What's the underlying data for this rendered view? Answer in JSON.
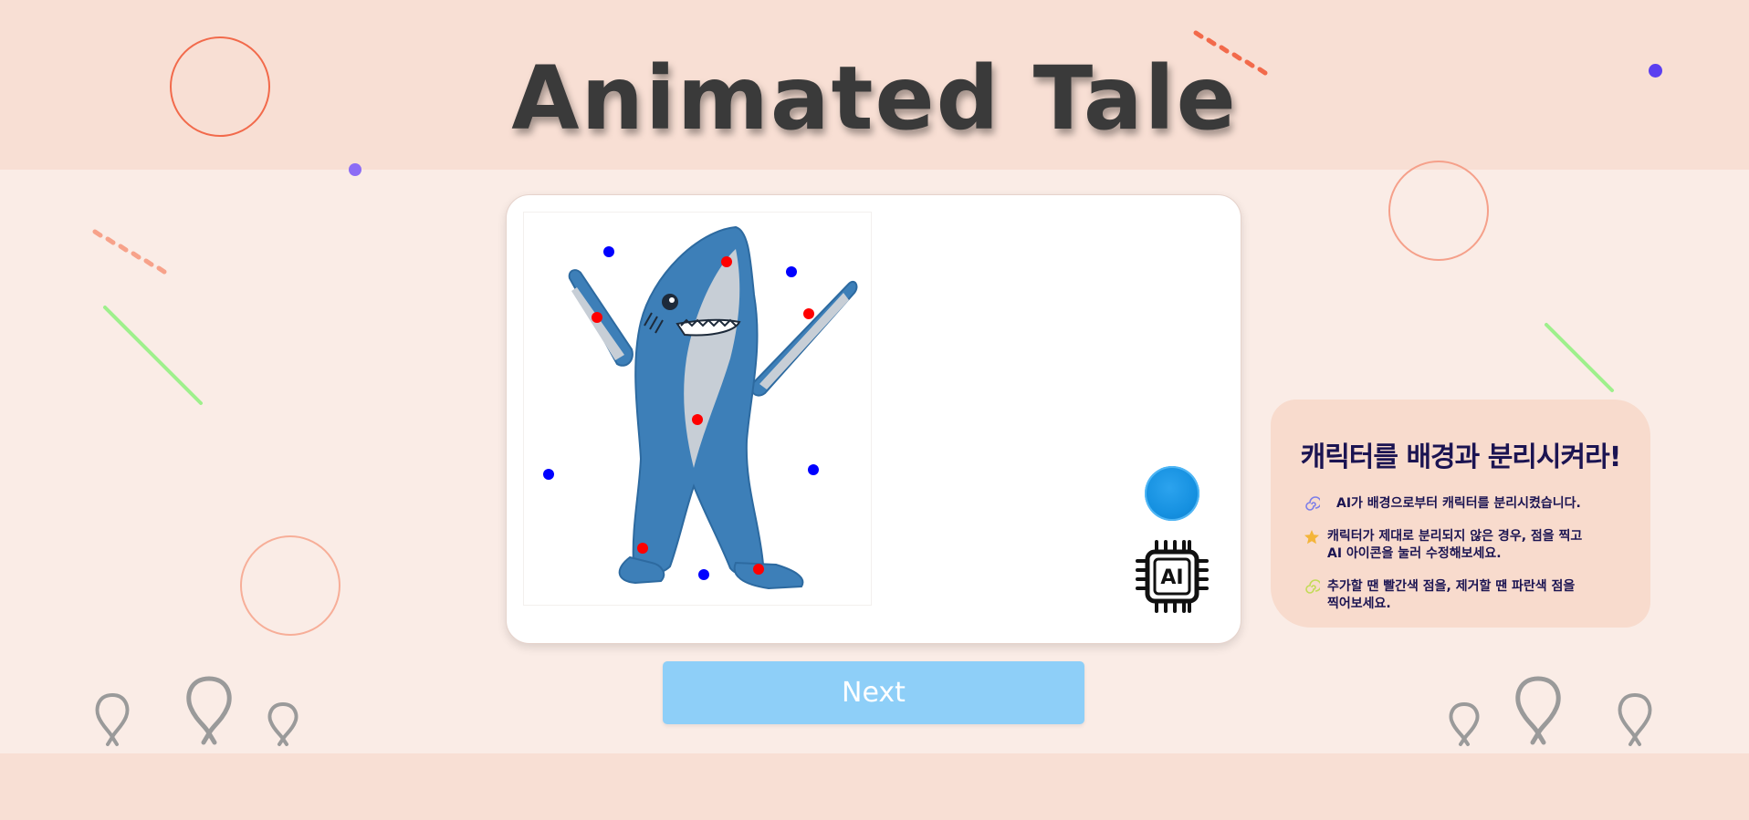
{
  "header": {
    "title": "Animated Tale"
  },
  "card": {
    "image_alt": "shark character",
    "orb_label": "",
    "ai_label": "AI"
  },
  "next_button": {
    "label": "Next"
  },
  "info": {
    "title": "캐릭터를 배경과 분리시켜라!",
    "items": [
      {
        "icon": "spiral-icon",
        "line1": "AI가 배경으로부터 캐릭터를 분리시켰습니다.",
        "line2": ""
      },
      {
        "icon": "star-icon",
        "line1": "캐릭터가 제대로 분리되지 않은 경우, 점을 찍고",
        "line2": "AI 아이콘을 눌러 수정해보세요."
      },
      {
        "icon": "spiral-icon",
        "line1": "추가할 땐 빨간색 점을, 제거할 땐 파란색 점을",
        "line2": "찍어보세요."
      }
    ]
  },
  "colors": {
    "band": "#f8dfd4",
    "background": "#faece6",
    "red_point": "#ff0000",
    "blue_point": "#0000ff",
    "next_button": "#8ecff8",
    "info_text": "#1b1452"
  }
}
